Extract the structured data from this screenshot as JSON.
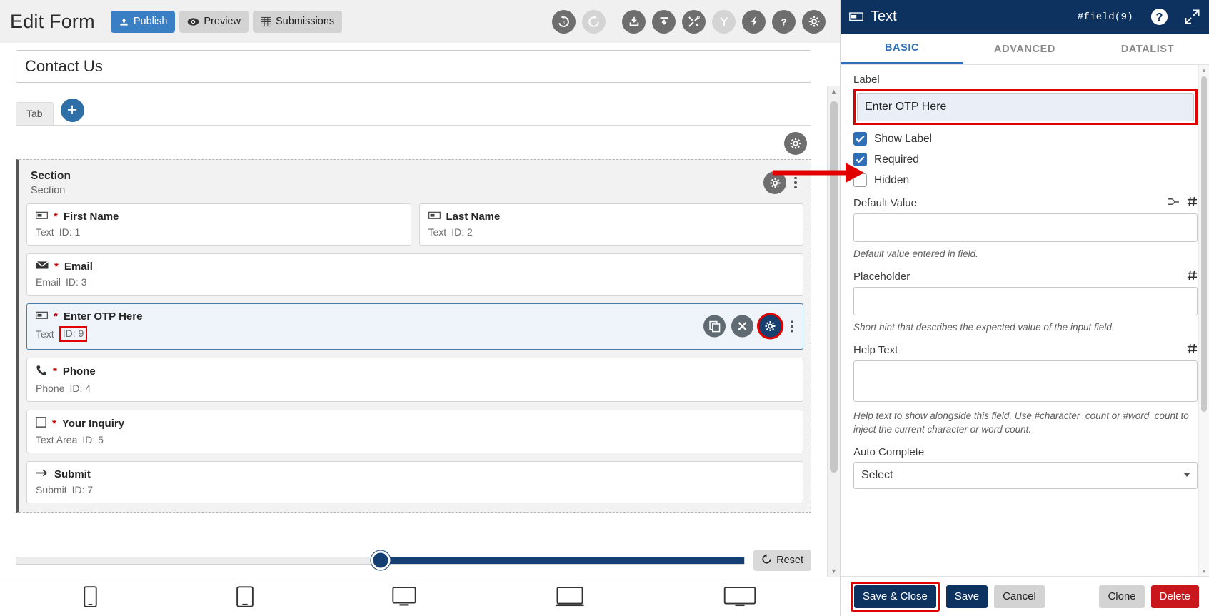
{
  "builder": {
    "header": {
      "title": "Edit Form",
      "buttons": [
        {
          "label": "Publish",
          "icon": "publish-icon",
          "style": "primary"
        },
        {
          "label": "Preview",
          "icon": "eye-icon",
          "style": "grey"
        },
        {
          "label": "Submissions",
          "icon": "table-icon",
          "style": "grey"
        }
      ],
      "tools": [
        {
          "name": "undo-history-icon",
          "state": "enabled"
        },
        {
          "name": "redo-icon",
          "state": "disabled"
        },
        {
          "name": "import-icon",
          "state": "enabled"
        },
        {
          "name": "export-icon",
          "state": "enabled"
        },
        {
          "name": "tools-icon",
          "state": "enabled"
        },
        {
          "name": "branch-icon",
          "state": "disabled"
        },
        {
          "name": "lightning-icon",
          "state": "enabled"
        },
        {
          "name": "help-icon",
          "state": "enabled"
        },
        {
          "name": "settings-gear-icon",
          "state": "enabled"
        }
      ]
    },
    "form_name": "Contact Us",
    "tab": {
      "label": "Tab",
      "add_label": "+"
    },
    "section": {
      "title": "Section",
      "subtitle": "Section"
    },
    "fields": [
      {
        "label": "First Name",
        "required": true,
        "type": "Text",
        "id_text": "ID: 1",
        "icon": "text-field-icon",
        "half": true
      },
      {
        "label": "Last Name",
        "required": false,
        "type": "Text",
        "id_text": "ID: 2",
        "icon": "text-field-icon",
        "half": true
      },
      {
        "label": "Email",
        "required": true,
        "type": "Email",
        "id_text": "ID: 3",
        "icon": "envelope-icon",
        "half": false
      },
      {
        "label": "Enter OTP Here",
        "required": true,
        "type": "Text",
        "id_text": "ID: 9",
        "icon": "text-field-icon",
        "half": false,
        "selected": true
      },
      {
        "label": "Phone",
        "required": true,
        "type": "Phone",
        "id_text": "ID: 4",
        "icon": "phone-icon",
        "half": false
      },
      {
        "label": "Your Inquiry",
        "required": true,
        "type": "Text Area",
        "id_text": "ID: 5",
        "icon": "textarea-icon",
        "half": false
      },
      {
        "label": "Submit",
        "required": false,
        "type": "Submit",
        "id_text": "ID: 7",
        "icon": "arrow-right-icon",
        "half": false
      }
    ],
    "row_actions": {
      "clone": "clone-icon",
      "delete": "close-icon",
      "settings": "gear-icon",
      "more": "kebab-menu-icon"
    },
    "slider": {
      "reset_label": "Reset",
      "position_percent": 50
    },
    "devices": [
      {
        "name": "device-mobile-icon"
      },
      {
        "name": "device-tablet-small-icon"
      },
      {
        "name": "device-tablet-icon"
      },
      {
        "name": "device-laptop-icon"
      },
      {
        "name": "device-desktop-icon"
      }
    ]
  },
  "panel": {
    "header": {
      "icon": "text-field-icon",
      "title": "Text",
      "field_id": "#field(9)",
      "help_icon": "help-circle-icon",
      "expand_icon": "expand-icon"
    },
    "tabs": [
      {
        "label": "BASIC",
        "active": true
      },
      {
        "label": "ADVANCED",
        "active": false
      },
      {
        "label": "DATALIST",
        "active": false
      }
    ],
    "fields": {
      "label_caption": "Label",
      "label_value": "Enter OTP Here",
      "show_label": {
        "label": "Show Label",
        "checked": true
      },
      "required": {
        "label": "Required",
        "checked": true
      },
      "hidden": {
        "label": "Hidden",
        "checked": false
      },
      "default_value_caption": "Default Value",
      "default_value": "",
      "default_value_hint": "Default value entered in field.",
      "placeholder_caption": "Placeholder",
      "placeholder_value": "",
      "placeholder_hint": "Short hint that describes the expected value of the input field.",
      "help_text_caption": "Help Text",
      "help_text_value": "",
      "help_text_hint": "Help text to show alongside this field. Use #character_count or #word_count to inject the current character or word count.",
      "auto_complete_caption": "Auto Complete",
      "auto_complete_value": "Select"
    },
    "footer": [
      {
        "label": "Save & Close",
        "style": "navy",
        "annotated": true
      },
      {
        "label": "Save",
        "style": "navy",
        "annotated": false
      },
      {
        "label": "Cancel",
        "style": "grey",
        "annotated": false
      },
      {
        "label": "Clone",
        "style": "grey",
        "annotated": false
      },
      {
        "label": "Delete",
        "style": "red",
        "annotated": false
      }
    ]
  },
  "annotations": {
    "accent_red": "#e00000",
    "accent_navy": "#0d3260",
    "accent_blue": "#2e6fb7"
  }
}
